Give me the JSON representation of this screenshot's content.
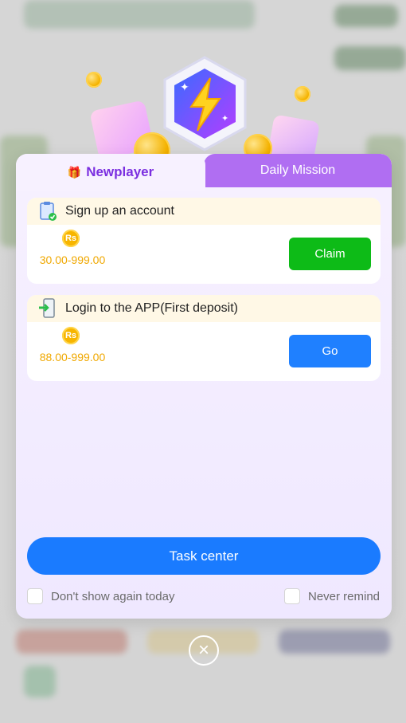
{
  "tabs": {
    "newplayer": "Newplayer",
    "daily_mission": "Daily Mission"
  },
  "tasks": [
    {
      "title": "Sign up an account",
      "currency": "Rs",
      "amount": "30.00-999.00",
      "action": "Claim",
      "action_color": "#0dbb17",
      "icon": "clipboard-check-icon"
    },
    {
      "title": "Login to the APP(First deposit)",
      "currency": "Rs",
      "amount": "88.00-999.00",
      "action": "Go",
      "action_color": "#1f80ff",
      "icon": "phone-login-icon"
    }
  ],
  "footer": {
    "task_center": "Task center",
    "dont_show_today": "Don't show again today",
    "never_remind": "Never remind"
  },
  "colors": {
    "accent_purple": "#7b2fe0",
    "tab_inactive": "#b06ef2",
    "primary_blue": "#1a7bff",
    "coin_gold": "#f0a800"
  }
}
